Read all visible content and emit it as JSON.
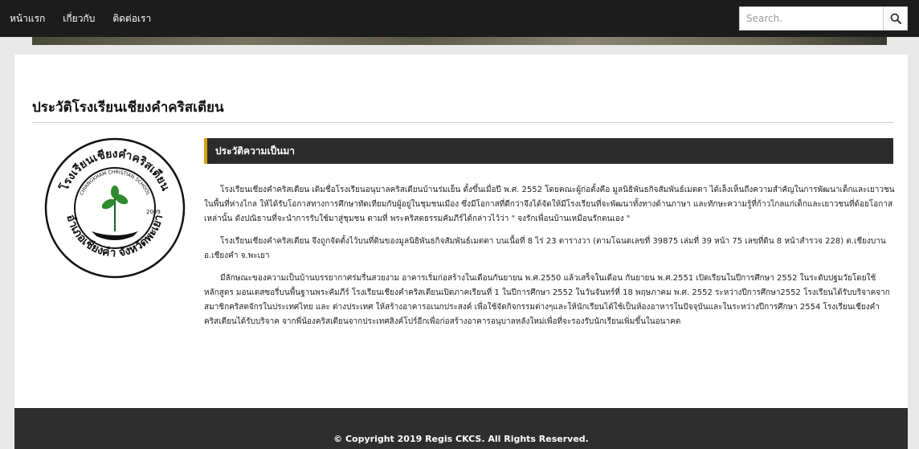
{
  "nav": {
    "items": [
      {
        "label": "หน้าแรก"
      },
      {
        "label": "เกี่ยวกับ"
      },
      {
        "label": "ติดต่อเรา"
      }
    ],
    "search": {
      "placeholder": "Search.",
      "icon": "search-icon"
    }
  },
  "page": {
    "title": "ประวัติโรงเรียนเชียงคำคริสเตียน"
  },
  "logo": {
    "text_top": "โรงเรียนเชียงคำคริสเตียน",
    "text_bottom": "อำเภอเชียงคำ จังหวัดพะเยา",
    "inner_text": "CHIANGKHAM CHRISTIAN SCHOOL",
    "year": "2009",
    "colors": {
      "ring": "#111111",
      "plant": "#2e8b2e"
    }
  },
  "section": {
    "header": "ประวัติความเป็นมา",
    "accent_color": "#d4a017",
    "paragraphs": [
      "โรงเรียนเชียงคำคริสเตียน เดิมชื่อโรงเรียนอนุบาลคริสเตียนบ้านร่มเย็น ตั้งขึ้นเมื่อปี พ.ศ. 2552 โดยคณะผู้ก่อตั้งคือ มูลนิธิพันธกิจสัมพันธ์เมตตา ได้เล็งเห็นถึงความสำคัญในการพัฒนาเด็กและเยาวชนในพื้นที่ห่างไกล ให้ได้รับโอกาสทางการศึกษาทัดเทียมกับผู้อยู่ในชุมชนเมือง ซึ่งมีโอกาสที่ดีกว่าจึงได้จัดให้มีโรงเรียนที่จะพัฒนาทั้งทางด้านภาษา และทักษะความรู้ที่ก้าวไกลแก่เด็กและเยาวชนที่ด้อยโอกาสเหล่านั้น ดังปณิธานที่จะนำการรับใช้มาสู่ชุมชน ตามที่ พระคริสตธรรมคัมภีร์ได้กล่าวไว้ว่า \" จงรักเพื่อนบ้านเหมือนรักตนเอง \"",
      "โรงเรียนเชียงคำคริสเตียน จึงถูกจัดตั้งไว้บนที่ดินของมูลนิธิพันธกิจสัมพันธ์เมตตา บนเนื้อที่ 8 ไร่ 23 ตารางวา (ตามโฉนดเลขที่ 39875 เล่มที่ 39 หน้า 75 เลขที่ดิน 8 หน้าสำรวจ 228) ต.เชียงบาน อ.เชียงคำ จ.พะเยา",
      "มีลักษณะของความเป็นบ้านบรรยากาศร่มรื่นสวยงาม อาคารเริ่มก่อสร้างในเดือนกันยายน พ.ศ.2550 แล้วเสร็จในเดือน กันยายน พ.ศ.2551 เปิดเรียนในปีการศึกษา 2552 ในระดับปฐมวัยโดยใช้หลักสูตร มอนเตสซอรี่บนพื้นฐานพระคัมภีร์ โรงเรียนเชียงคำคริสเตียนเปิดภาคเรียนที่ 1 ในปีการศึกษา 2552 ในวันจันทร์ที่ 18 พฤษภาคม พ.ศ. 2552 ระหว่างปีการศึกษา2552 โรงเรียนได้รับบริจาคจากสมาชิกคริสตจักรในประเทศไทย และ ต่างประเทศ ให้สร้างอาคารอเนกประสงค์ เพื่อใช้จัดกิจกรรมต่างๆและให้นักเรียนได้ใช้เป็นห้องอาหารในปัจจุบันและในระหว่างปีการศึกษา 2554 โรงเรียนเชียงคำคริสเตียนได้รับบริจาค จากพี่น้องคริสเตียนจากประเทศสิงค์โปร์อีกเพื่อก่อสร้างอาคารอนุบาลหลังใหม่เพื่อที่จะรองรับนักเรียนเพิ่มขึ้นในอนาคต"
    ]
  },
  "footer": {
    "text": "© Copyright 2019 Regis CKCS. All Rights Reserved."
  }
}
